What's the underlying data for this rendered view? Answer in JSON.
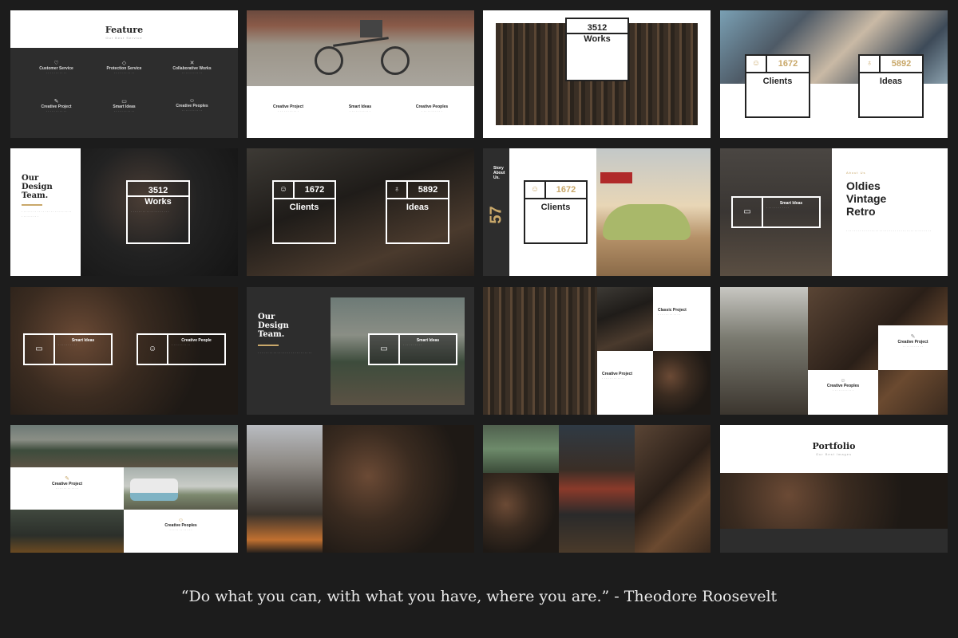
{
  "slides": {
    "feature": {
      "title": "Feature",
      "subtitle": "Our Best Service",
      "items": [
        "Customer Service",
        "Protection Service",
        "Collaborative Works",
        "Creative Project",
        "Smart Ideas",
        "Creative Peoples"
      ]
    },
    "bike": {
      "items": [
        "Creative Project",
        "Smart Ideas",
        "Creative Peoples"
      ]
    },
    "works1": {
      "num": "3512",
      "label": "Works"
    },
    "clients_ideas1": {
      "clients_num": "1672",
      "clients": "Clients",
      "ideas_num": "5892",
      "ideas": "Ideas"
    },
    "team1": {
      "title_l1": "Our",
      "title_l2": "Design",
      "title_l3": "Team.",
      "num": "3512",
      "label": "Works"
    },
    "clients_ideas2": {
      "clients_num": "1672",
      "clients": "Clients",
      "ideas_num": "5892",
      "ideas": "Ideas"
    },
    "story": {
      "side": "Story About Us.",
      "big": "57",
      "num": "1672",
      "label": "Clients"
    },
    "oldies": {
      "small": "About Us",
      "l1": "Oldies",
      "l2": "Vintage",
      "l3": "Retro",
      "box_title": "Smart Ideas"
    },
    "kettle_icons": {
      "a": "Smart Ideas",
      "b": "Creative People"
    },
    "team2": {
      "title_l1": "Our",
      "title_l2": "Design",
      "title_l3": "Team.",
      "box_title": "Smart Ideas"
    },
    "tools2": {
      "a": "Classic Project",
      "b": "Creative Project"
    },
    "cafe": {
      "a": "Creative Project",
      "b": "Creative Peoples"
    },
    "forest": {
      "a": "Creative Project",
      "b": "Creative Peoples"
    },
    "portfolio": {
      "title": "Portfolio",
      "subtitle": "Our Best Images"
    }
  },
  "quote": "“Do what you can, with what you have, where you are.” - Theodore Roosevelt",
  "colors": {
    "background": "#1c1c1c",
    "accent": "#c9a86a"
  }
}
